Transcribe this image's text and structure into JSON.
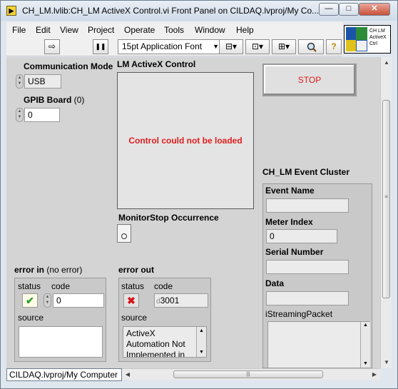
{
  "window": {
    "title": "CH_LM.lvlib:CH_LM ActiveX Control.vi Front Panel on CILDAQ.lvproj/My Co...",
    "app_icon_glyph": "▶",
    "min_glyph": "—",
    "max_glyph": "□",
    "close_glyph": "✕"
  },
  "menu": [
    "File",
    "Edit",
    "View",
    "Project",
    "Operate",
    "Tools",
    "Window",
    "Help"
  ],
  "toolbar": {
    "run_icon": "⇨",
    "pause_icon": "❚❚",
    "font": "15pt Application Font",
    "dropdown_arrow": "▼",
    "align_icon": "⊟▾",
    "distribute_icon": "⊡▾",
    "resize_icon": "⊞▾",
    "help_icon": "?"
  },
  "vi_icon": {
    "text": "CH LM ActiveX Ctrl"
  },
  "controls": {
    "comm_mode": {
      "label": "Communication Mode",
      "value": "USB"
    },
    "gpib": {
      "label": "GPIB Board",
      "suffix": " (0)",
      "value": "0"
    },
    "activex": {
      "label": "LM ActiveX Control",
      "error": "Control could not be loaded"
    },
    "stop": {
      "label": "STOP"
    },
    "occurrence": {
      "label": "MonitorStop Occurrence"
    },
    "event_cluster": {
      "label": "CH_LM Event Cluster",
      "event_name": {
        "label": "Event Name",
        "value": ""
      },
      "meter_index": {
        "label": "Meter Index",
        "value": "0"
      },
      "serial_number": {
        "label": "Serial  Number",
        "value": ""
      },
      "data": {
        "label": "Data",
        "value": ""
      },
      "streaming_packet": {
        "label": "iStreamingPacket"
      }
    },
    "error_in": {
      "label": "error in",
      "note": " (no error)",
      "status_label": "status",
      "status_icon": "✔",
      "code_label": "code",
      "code_value": "0",
      "source_label": "source",
      "source_value": ""
    },
    "error_out": {
      "label": "error out",
      "status_label": "status",
      "status_icon": "✖",
      "code_label": "code",
      "code_value": "3001",
      "code_prefix": "d",
      "source_label": "source",
      "source_value": "ActiveX Automation Not Implemented in"
    }
  },
  "status_bar": {
    "context": "CILDAQ.lvproj/My Computer"
  },
  "scroll": {
    "up": "▲",
    "down": "▼",
    "left": "◀",
    "right": "▶",
    "grip": "≡",
    "hgrip": "|||"
  }
}
